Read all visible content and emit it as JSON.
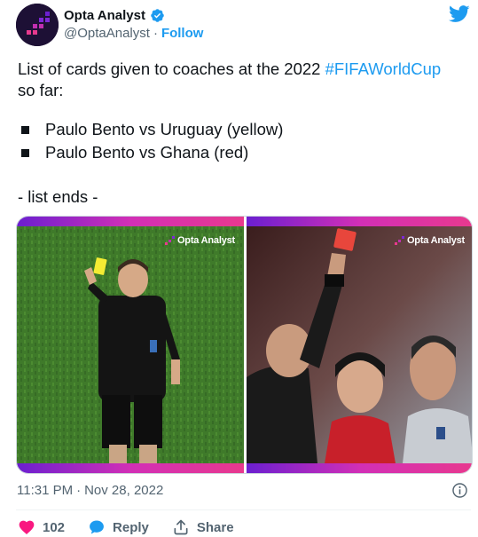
{
  "tweet": {
    "author": {
      "display_name": "Opta Analyst",
      "handle": "@OptaAnalyst",
      "follow_label": "Follow",
      "verified": true,
      "separator": "·"
    },
    "text": {
      "line1_plain": "List of cards given to coaches at the 2022 ",
      "hashtag": "#FIFAWorldCup",
      "line2": "so far:",
      "bullets": [
        "Paulo Bento vs Uruguay (yellow)",
        "Paulo Bento vs Ghana (red)"
      ],
      "closing": "- list ends -"
    },
    "media": {
      "watermark_left": "Opta Analyst",
      "watermark_right": "Opta Analyst",
      "left_image_icon": "referee-yellow-card-photo",
      "right_image_icon": "referee-red-card-photo"
    },
    "timestamp": {
      "time": "11:31 PM",
      "separator": "·",
      "date": "Nov 28, 2022"
    },
    "actions": {
      "like_count": "102",
      "reply_label": "Reply",
      "share_label": "Share"
    }
  },
  "colors": {
    "accent": "#1d9bf0",
    "like": "#f91880",
    "text": "#0f1419",
    "muted": "#536471",
    "brand_gradient_start": "#6b1fd0",
    "brand_gradient_end": "#e8398e"
  },
  "icons": [
    "opta-logo-icon",
    "verified-badge-icon",
    "twitter-bird-icon",
    "info-icon",
    "heart-icon",
    "reply-bubble-icon",
    "share-icon"
  ]
}
